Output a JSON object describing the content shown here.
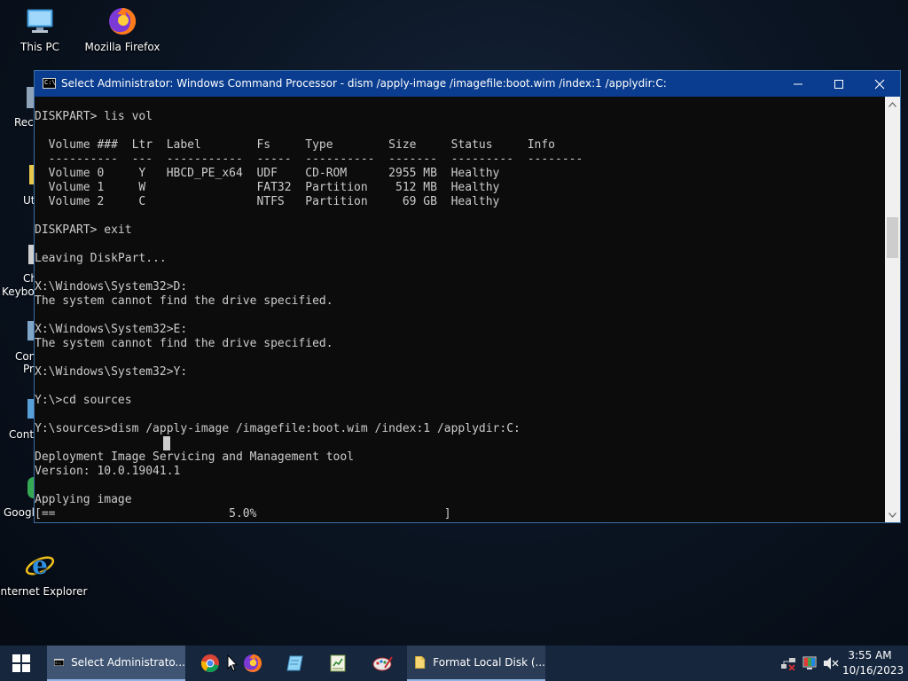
{
  "desktop": {
    "icons": [
      {
        "label": "This PC",
        "icon": "this-pc-icon"
      },
      {
        "label": "Mozilla Firefox",
        "icon": "firefox-icon"
      },
      {
        "label": "Internet Explorer",
        "icon": "internet-explorer-icon"
      }
    ],
    "partial_labels": [
      "Recy",
      "Ut",
      "Ch",
      "Keybo",
      "Con",
      "Pr",
      "Cont",
      "Google"
    ]
  },
  "window": {
    "title": "Select Administrator: Windows Command Processor - dism  /apply-image /imagefile:boot.wim /index:1 /applydir:C:",
    "minimize_glyph": "–",
    "maximize_glyph": "☐",
    "close_glyph": "✕",
    "console_lines": [
      "DISKPART> lis vol",
      "",
      "  Volume ###  Ltr  Label        Fs     Type        Size     Status     Info",
      "  ----------  ---  -----------  -----  ----------  -------  ---------  --------",
      "  Volume 0     Y   HBCD_PE_x64  UDF    CD-ROM      2955 MB  Healthy",
      "  Volume 1     W                FAT32  Partition    512 MB  Healthy",
      "  Volume 2     C                NTFS   Partition     69 GB  Healthy",
      "",
      "DISKPART> exit",
      "",
      "Leaving DiskPart...",
      "",
      "X:\\Windows\\System32>D:",
      "The system cannot find the drive specified.",
      "",
      "X:\\Windows\\System32>E:",
      "The system cannot find the drive specified.",
      "",
      "X:\\Windows\\System32>Y:",
      "",
      "Y:\\>cd sources",
      "",
      "Y:\\sources>dism /apply-image /imagefile:boot.wim /index:1 /applydir:C:",
      "",
      "Deployment Image Servicing and Management tool",
      "Version: 10.0.19041.1",
      "",
      "Applying image",
      "[==                         5.0%                           ]"
    ],
    "progress_percent": 5.0
  },
  "taskbar": {
    "start_icon": "windows-logo-icon",
    "apps": [
      {
        "label": "Select Administrato...",
        "icon": "cmd-icon",
        "state": "active"
      },
      {
        "label": "",
        "icon": "chrome-icon",
        "state": "pinned"
      },
      {
        "label": "",
        "icon": "firefox-icon",
        "state": "pinned"
      },
      {
        "label": "",
        "icon": "notepad-icon",
        "state": "pinned"
      },
      {
        "label": "",
        "icon": "spreadsheet-icon",
        "state": "pinned"
      },
      {
        "label": "",
        "icon": "paint-icon",
        "state": "pinned"
      },
      {
        "label": "Format Local Disk (...",
        "icon": "folder-icon",
        "state": "open"
      }
    ],
    "tray": [
      "network-icon",
      "color-icon",
      "volume-muted-icon"
    ],
    "clock": {
      "time": "3:55 AM",
      "date": "10/16/2023"
    }
  },
  "colors": {
    "titlebar": "#0a3d8f",
    "console_bg": "#0c0c0c",
    "console_text": "#cccccc",
    "taskbar": "#15263d"
  }
}
